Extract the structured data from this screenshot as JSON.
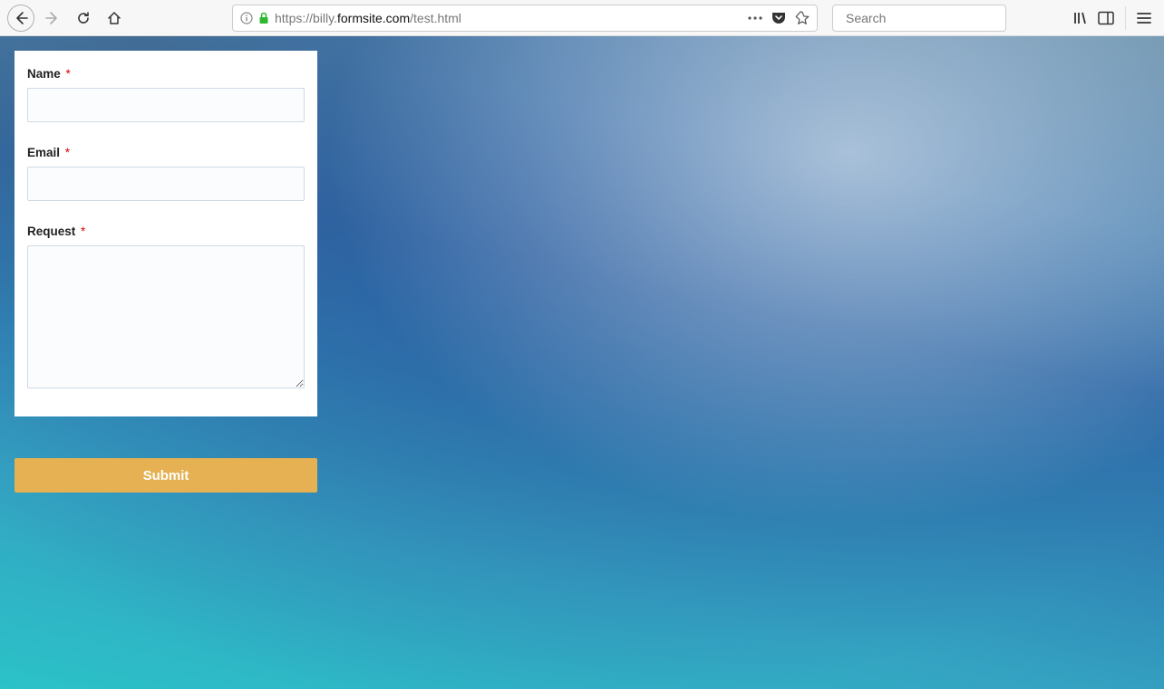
{
  "browser": {
    "url_prefix": "https://billy.",
    "url_domain": "formsite.com",
    "url_path": "/test.html",
    "search_placeholder": "Search"
  },
  "form": {
    "name_label": "Name",
    "email_label": "Email",
    "request_label": "Request",
    "required_mark": "*",
    "name_value": "",
    "email_value": "",
    "request_value": "",
    "submit_label": "Submit"
  }
}
